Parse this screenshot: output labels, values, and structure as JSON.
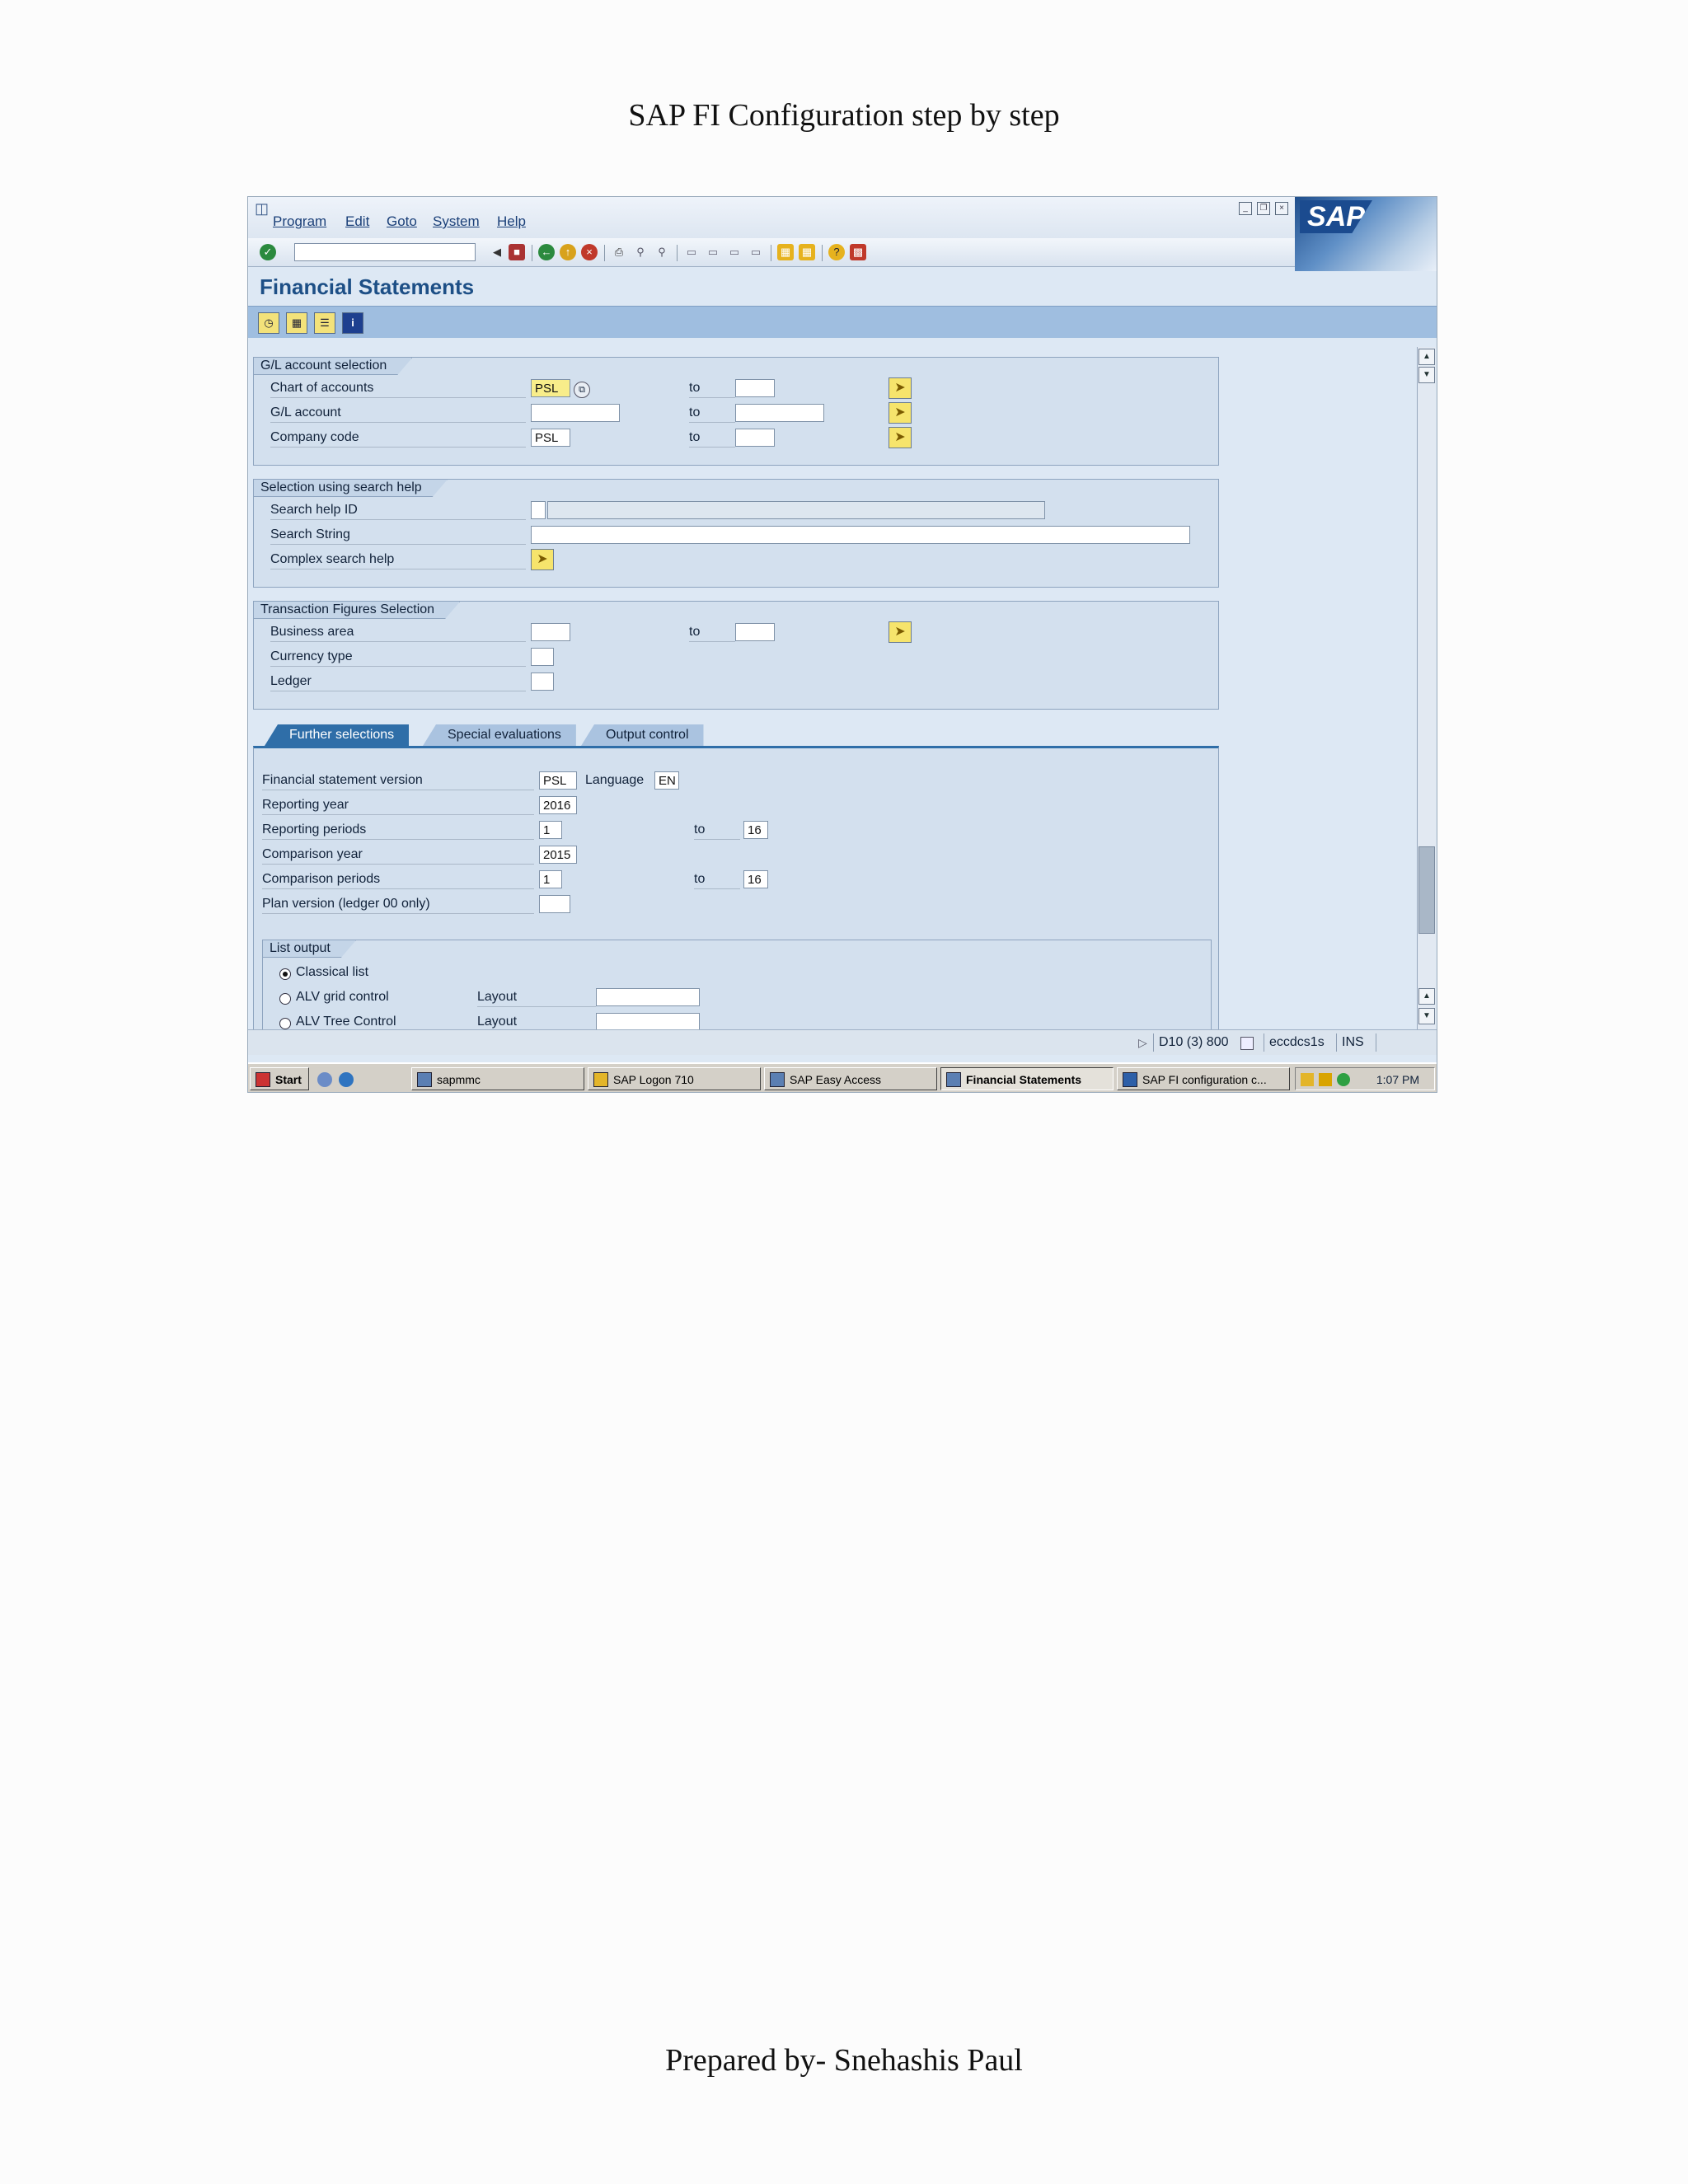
{
  "document": {
    "title": "SAP FI Configuration step by step",
    "footer": "Prepared by- Snehashis Paul"
  },
  "menu": [
    "Program",
    "Edit",
    "Goto",
    "System",
    "Help"
  ],
  "screen_title": "Financial Statements",
  "gl_selection": {
    "title": "G/L account selection",
    "to_label": "to",
    "rows": [
      {
        "label": "Chart of accounts",
        "value": "PSL"
      },
      {
        "label": "G/L account",
        "value": ""
      },
      {
        "label": "Company code",
        "value": "PSL"
      }
    ]
  },
  "search_help": {
    "title": "Selection using search help",
    "rows": [
      "Search help ID",
      "Search String",
      "Complex search help"
    ]
  },
  "transaction_figures": {
    "title": "Transaction Figures Selection",
    "to_label": "to",
    "rows": [
      "Business area",
      "Currency type",
      "Ledger"
    ]
  },
  "tabs": [
    "Further selections",
    "Special evaluations",
    "Output control"
  ],
  "further": {
    "to_label": "to",
    "language_label": "Language",
    "language_value": "EN",
    "rows": [
      {
        "label": "Financial statement version",
        "value": "PSL"
      },
      {
        "label": "Reporting year",
        "value": "2016"
      },
      {
        "label": "Reporting periods",
        "value": "1",
        "to": "16"
      },
      {
        "label": "Comparison year",
        "value": "2015"
      },
      {
        "label": "Comparison periods",
        "value": "1",
        "to": "16"
      },
      {
        "label": "Plan version (ledger 00 only)",
        "value": ""
      }
    ]
  },
  "list_output": {
    "title": "List output",
    "options": [
      "Classical list",
      "ALV grid control",
      "ALV Tree Control"
    ],
    "layout_label": "Layout"
  },
  "status": {
    "system": "D10 (3) 800",
    "server": "eccdcs1s",
    "mode": "INS"
  },
  "taskbar": {
    "start": "Start",
    "items": [
      "sapmmc",
      "SAP Logon 710",
      "SAP Easy Access",
      "Financial Statements",
      "SAP FI configuration c..."
    ],
    "time": "1:07 PM"
  },
  "colors": {
    "accent": "#1d4f86",
    "app_toolbar": "#9fbee0",
    "panel": "#d3e0ee",
    "active_tab": "#2f6ea8"
  }
}
